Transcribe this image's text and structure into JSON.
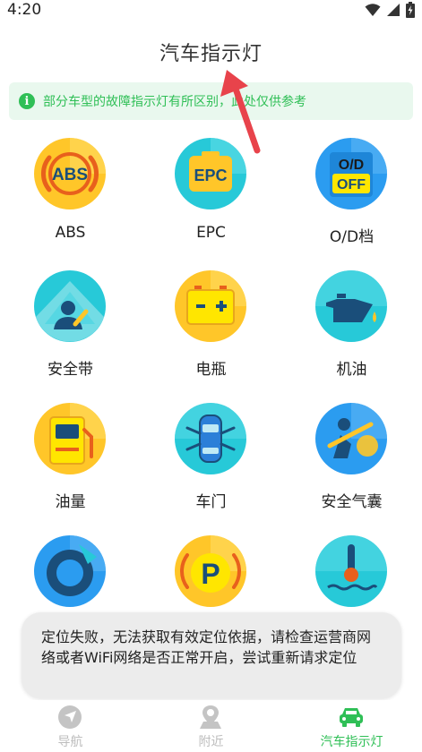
{
  "status": {
    "time": "4:20"
  },
  "header": {
    "title": "汽车指示灯"
  },
  "notice": {
    "icon": "info-icon",
    "text": "部分车型的故障指示灯有所区别，此处仅供参考"
  },
  "grid": {
    "items": [
      {
        "label": "ABS",
        "icon": "abs-icon",
        "icon_text": "ABS"
      },
      {
        "label": "EPC",
        "icon": "epc-icon",
        "icon_text": "EPC"
      },
      {
        "label": "O/D档",
        "icon": "od-off-icon",
        "icon_text_top": "O/D",
        "icon_text_bottom": "OFF"
      },
      {
        "label": "安全带",
        "icon": "seatbelt-icon"
      },
      {
        "label": "电瓶",
        "icon": "battery-icon"
      },
      {
        "label": "机油",
        "icon": "oil-can-icon"
      },
      {
        "label": "油量",
        "icon": "fuel-pump-icon"
      },
      {
        "label": "车门",
        "icon": "car-door-icon"
      },
      {
        "label": "安全气囊",
        "icon": "airbag-icon"
      },
      {
        "label": "",
        "icon": "tire-pressure-icon"
      },
      {
        "label": "",
        "icon": "parking-brake-icon",
        "icon_text": "P"
      },
      {
        "label": "",
        "icon": "coolant-temperature-icon"
      }
    ]
  },
  "toast": {
    "text": "定位失败，无法获取有效定位依据，请检查运营商网络或者WiFi网络是否正常开启，尝试重新请求定位"
  },
  "tabbar": {
    "tabs": [
      {
        "label": "导航",
        "icon": "navigation-icon",
        "active": false
      },
      {
        "label": "附近",
        "icon": "location-pin-icon",
        "active": false
      },
      {
        "label": "汽车指示灯",
        "icon": "car-icon",
        "active": true
      }
    ]
  },
  "colors": {
    "accent": "#2fbf56",
    "notice_bg": "#e9f8ee",
    "arrow": "#e8434b"
  }
}
